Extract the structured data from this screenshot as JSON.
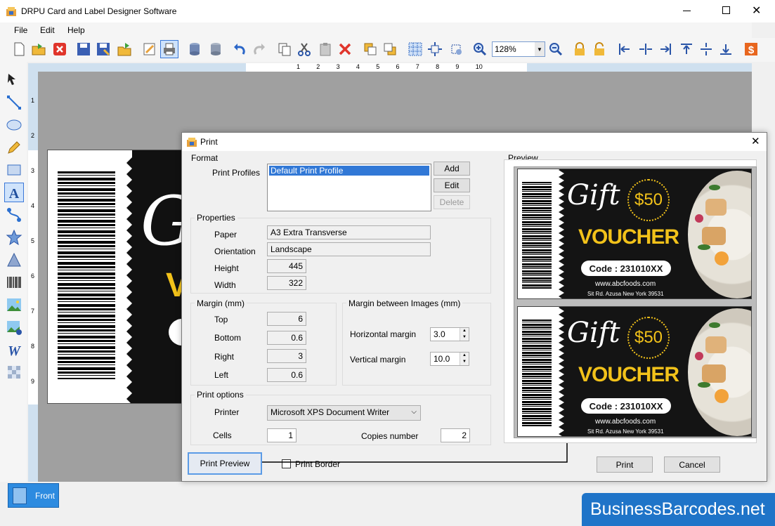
{
  "window": {
    "title": "DRPU Card and Label Designer Software"
  },
  "menu": [
    "File",
    "Edit",
    "Help"
  ],
  "zoom": "128%",
  "ruler_top": [
    "1",
    "2",
    "3",
    "4",
    "5",
    "6",
    "7",
    "8",
    "9",
    "10"
  ],
  "ruler_left": [
    "1",
    "2",
    "3",
    "4",
    "5",
    "6",
    "7",
    "8",
    "9"
  ],
  "card": {
    "heading": "G",
    "accent": "V"
  },
  "tab": {
    "label": "Front"
  },
  "watermark": "BusinessBarcodes.net",
  "dialog": {
    "title": "Print",
    "format_label": "Format",
    "profiles_label": "Print Profiles",
    "profiles": [
      "Default Print Profile"
    ],
    "add": "Add",
    "edit": "Edit",
    "delete": "Delete",
    "properties_label": "Properties",
    "paper_label": "Paper",
    "paper": "A3 Extra Transverse",
    "orientation_label": "Orientation",
    "orientation": "Landscape",
    "height_label": "Height",
    "height": "445",
    "width_label": "Width",
    "width": "322",
    "margin_label": "Margin (mm)",
    "top_label": "Top",
    "top": "6",
    "bottom_label": "Bottom",
    "bottom": "0.6",
    "right_label": "Right",
    "right": "3",
    "left_label": "Left",
    "left": "0.6",
    "mbi_label": "Margin between Images (mm)",
    "hmargin_label": "Horizontal margin",
    "hmargin": "3.0",
    "vmargin_label": "Vertical margin",
    "vmargin": "10.0",
    "printopts_label": "Print options",
    "printer_label": "Printer",
    "printer": "Microsoft XPS Document Writer",
    "cells_label": "Cells",
    "cells": "1",
    "copies_label": "Copies number",
    "copies": "2",
    "preview_label": "Preview",
    "print_preview": "Print Preview",
    "print_border": "Print Border",
    "print": "Print",
    "cancel": "Cancel"
  },
  "voucher": {
    "gift": "Gift",
    "price": "$50",
    "title": "VOUCHER",
    "code": "Code : 231010XX",
    "url": "www.abcfoods.com",
    "address": "Sit Rd. Azusa New York 39531"
  }
}
